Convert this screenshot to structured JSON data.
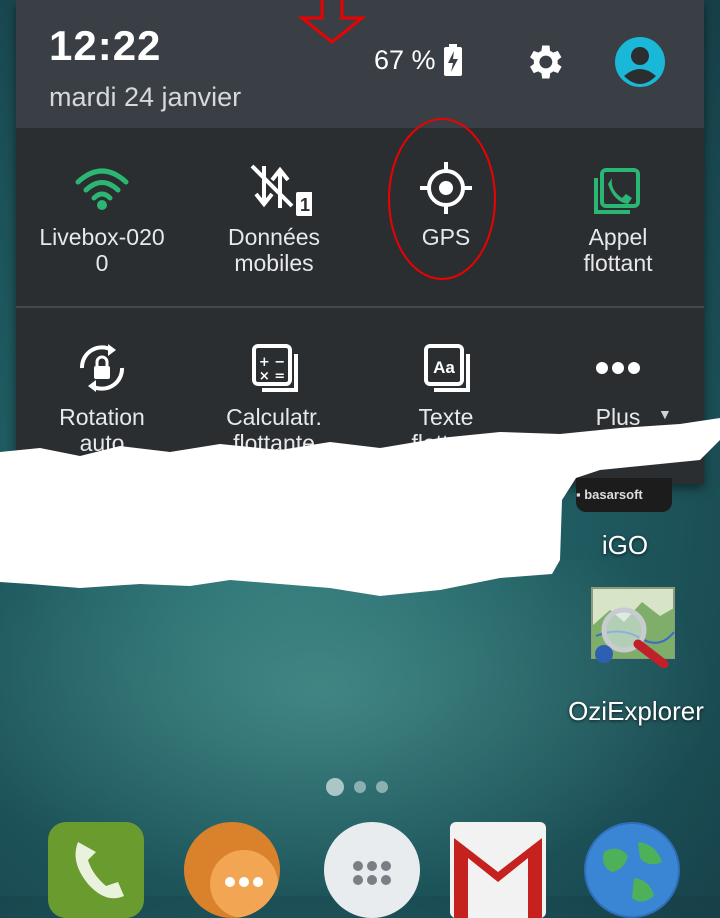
{
  "status": {
    "time": "12:22",
    "date": "mardi 24 janvier",
    "battery": "67 %"
  },
  "quick_settings": [
    {
      "label": "Livebox-020\n0",
      "icon": "wifi-icon"
    },
    {
      "label": "Données\nmobiles",
      "icon": "mobile-data-off-icon",
      "badge": "1"
    },
    {
      "label": "GPS",
      "icon": "gps-icon"
    },
    {
      "label": "Appel\nflottant",
      "icon": "floating-call-icon"
    },
    {
      "label": "Rotation\nauto",
      "icon": "auto-rotate-icon"
    },
    {
      "label": "Calculatr.\nflottante",
      "icon": "calculator-icon"
    },
    {
      "label": "Texte\nflottant",
      "icon": "floating-text-icon",
      "icon_text": "Aa"
    },
    {
      "label": "Plus",
      "icon": "more-icon"
    }
  ],
  "home": {
    "apps": [
      {
        "label": "iGO",
        "brand": "basarsoft"
      },
      {
        "label": "OziExplorer"
      }
    ],
    "dock_icons": [
      "phone-icon",
      "messages-icon",
      "app-drawer-icon",
      "gmail-icon",
      "browser-icon"
    ]
  },
  "colors": {
    "accent_green": "#2bb673",
    "account_cyan": "#1ab8d8",
    "annotation_red": "#e00000",
    "shade_bg": "#2b2e31",
    "header_bg": "#3a3f45"
  }
}
